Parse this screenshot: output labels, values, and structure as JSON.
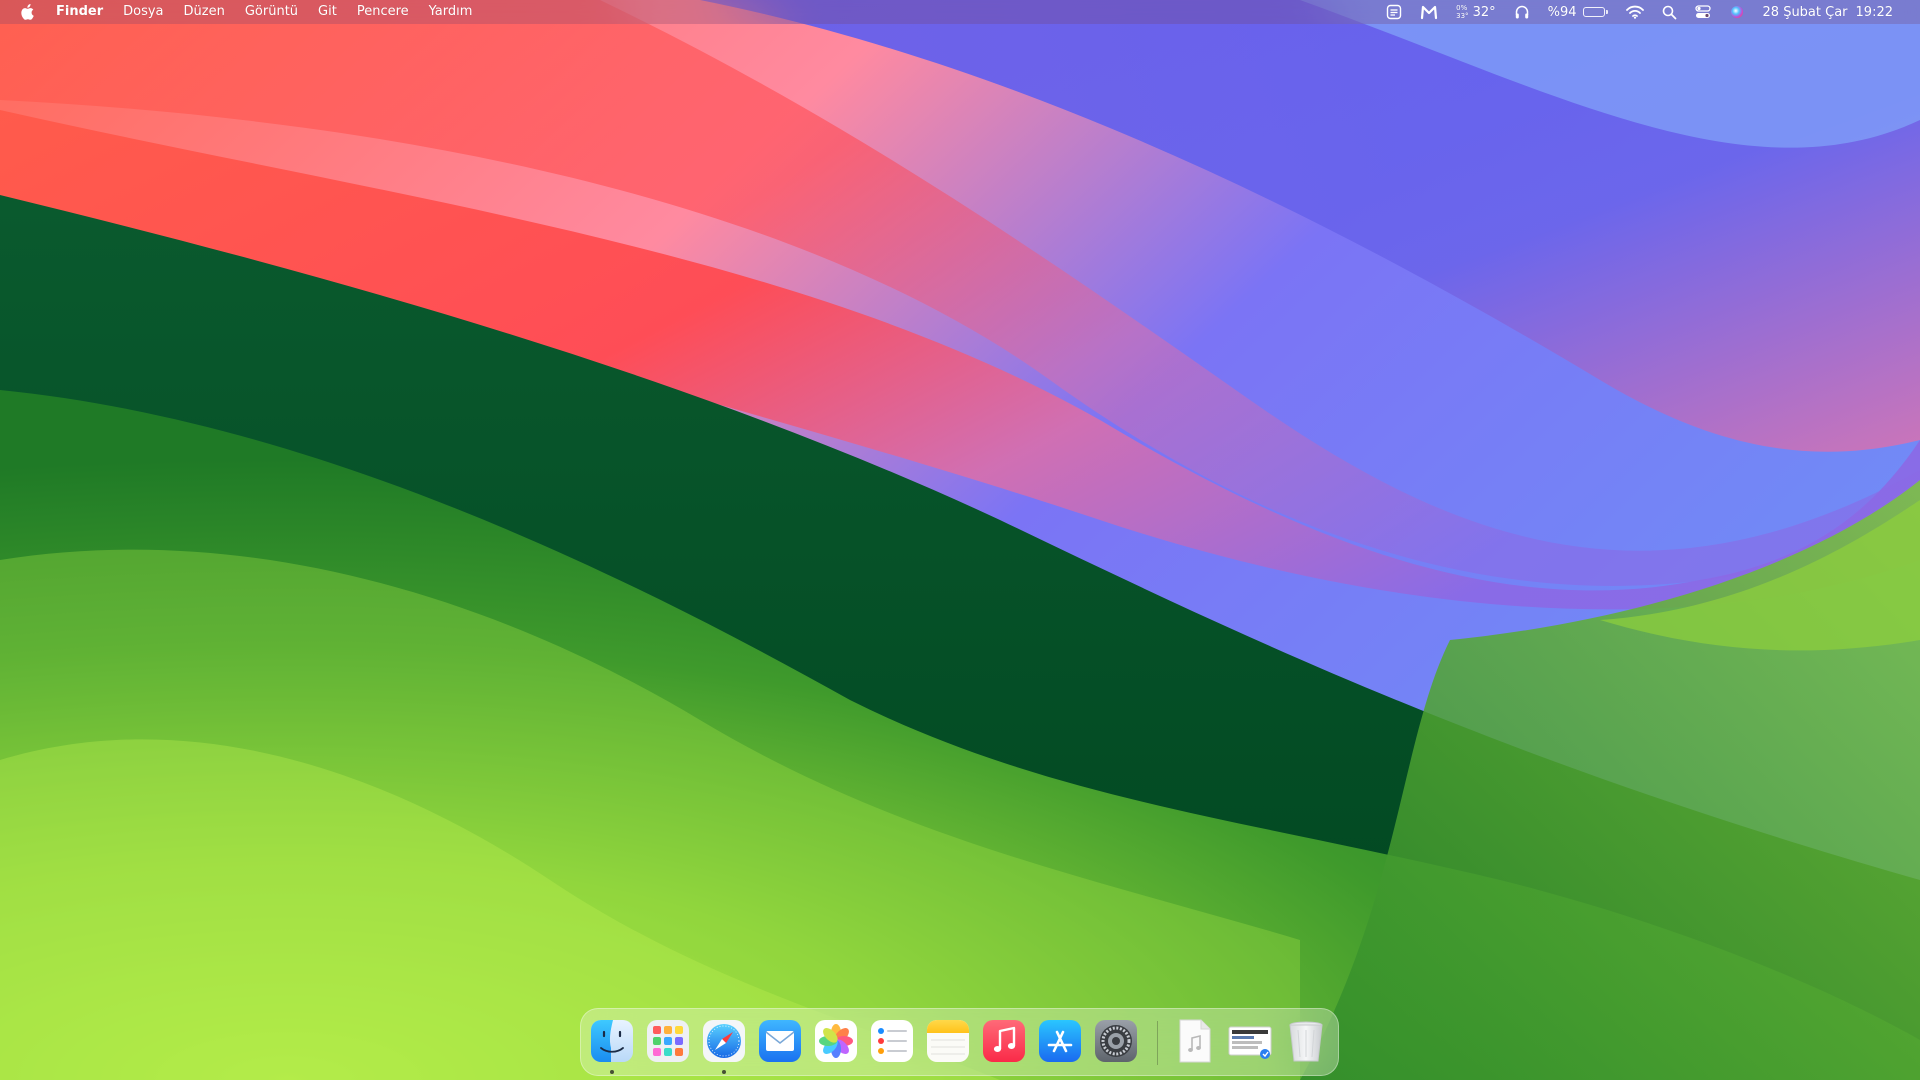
{
  "menubar": {
    "app_name": "Finder",
    "menus": [
      "Dosya",
      "Düzen",
      "Görüntü",
      "Git",
      "Pencere",
      "Yardım"
    ],
    "weather": {
      "line1": "0%",
      "line2": "33°",
      "temp": "32°"
    },
    "battery": {
      "label": "%94",
      "level": 0.94
    },
    "date": "28 Şubat Çar",
    "time": "19:22",
    "status_icons": [
      "screen-mirroring-icon",
      "malwarebytes-icon",
      "weather-icon",
      "headphones-icon",
      "battery-icon",
      "wifi-icon",
      "spotlight-search-icon",
      "control-center-icon",
      "siri-icon"
    ]
  },
  "dock": {
    "apps": [
      {
        "name": "Finder",
        "icon": "finder-icon",
        "running": true
      },
      {
        "name": "Launchpad",
        "icon": "launchpad-icon",
        "running": false
      },
      {
        "name": "Safari",
        "icon": "safari-icon",
        "running": true
      },
      {
        "name": "Mail",
        "icon": "mail-icon",
        "running": false
      },
      {
        "name": "Photos",
        "icon": "photos-icon",
        "running": false
      },
      {
        "name": "Reminders",
        "icon": "reminders-icon",
        "running": false
      },
      {
        "name": "Notes",
        "icon": "notes-icon",
        "running": false
      },
      {
        "name": "Music",
        "icon": "music-icon",
        "running": false
      },
      {
        "name": "App Store",
        "icon": "app-store-icon",
        "running": false
      },
      {
        "name": "System Settings",
        "icon": "system-settings-icon",
        "running": false
      }
    ],
    "recents": [
      {
        "name": "Audio file",
        "icon": "audio-document-icon"
      },
      {
        "name": "Screenshot",
        "icon": "screenshot-document-icon"
      },
      {
        "name": "Trash",
        "icon": "trash-icon"
      }
    ]
  },
  "colors": {
    "wallpaper_red": "#ff4a4f",
    "wallpaper_blue": "#6a6df2",
    "wallpaper_pink": "#d873b0",
    "wallpaper_dark_green": "#004f2a",
    "wallpaper_light_green": "#a6e843"
  }
}
